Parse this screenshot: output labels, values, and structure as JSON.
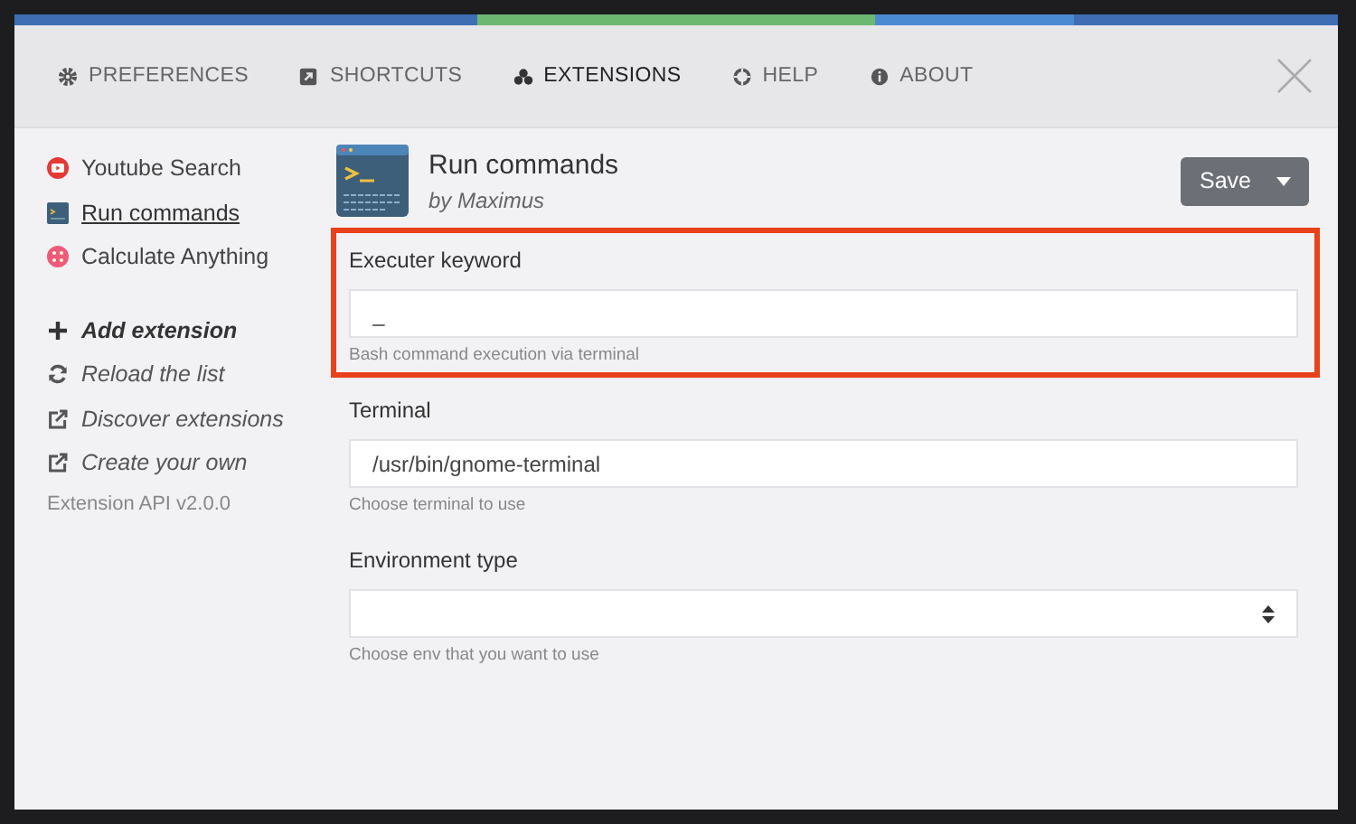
{
  "tabs": [
    {
      "label": "PREFERENCES",
      "kind": "gear",
      "selected": false
    },
    {
      "label": "SHORTCUTS",
      "kind": "shortcut",
      "selected": false
    },
    {
      "label": "EXTENSIONS",
      "kind": "puzzle",
      "selected": true
    },
    {
      "label": "HELP",
      "kind": "lifebuoy",
      "selected": false
    },
    {
      "label": "ABOUT",
      "kind": "info",
      "selected": false
    }
  ],
  "sidebar": {
    "extensions": [
      {
        "name": "Youtube Search",
        "kind": "youtube",
        "selected": false
      },
      {
        "name": "Run commands",
        "kind": "terminal",
        "selected": true
      },
      {
        "name": "Calculate Anything",
        "kind": "calculator",
        "selected": false
      }
    ],
    "actions": [
      {
        "label": "Add extension",
        "kind": "add"
      },
      {
        "label": "Reload the list",
        "kind": "reload"
      },
      {
        "label": "Discover extensions",
        "kind": "external"
      },
      {
        "label": "Create your own",
        "kind": "external"
      }
    ],
    "version": "Extension API v2.0.0"
  },
  "extension": {
    "name": "Run commands",
    "author": "by Maximus",
    "save_button": "Save"
  },
  "fields": [
    {
      "label": "Executer keyword",
      "kind": "text",
      "value": "_",
      "hint": "Bash command execution via terminal",
      "highlighted": true
    },
    {
      "label": "Terminal",
      "kind": "text",
      "value": "/usr/bin/gnome-terminal",
      "hint": "Choose terminal to use",
      "highlighted": false
    },
    {
      "label": "Environment type",
      "kind": "select",
      "hint": "Choose env that you want to use",
      "highlighted": false
    }
  ]
}
